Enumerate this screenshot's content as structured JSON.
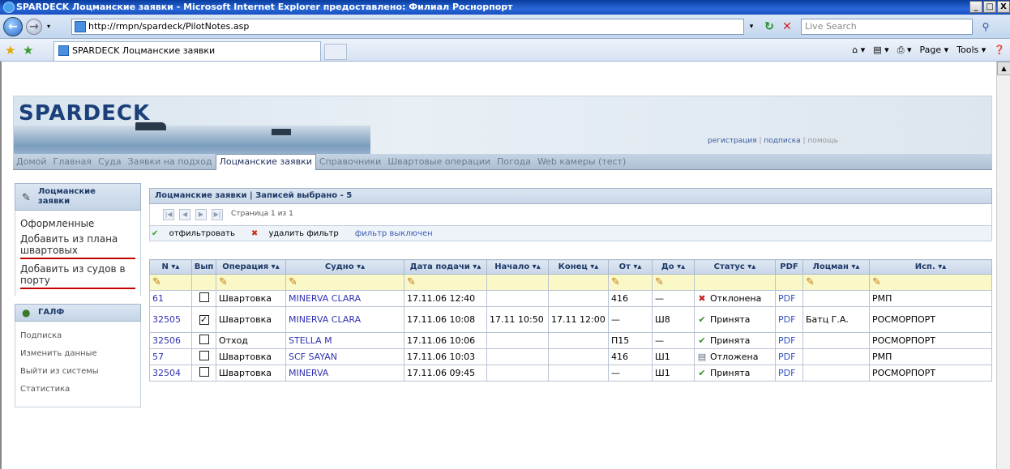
{
  "window": {
    "title": "SPARDECK Лоцманские заявки - Microsoft Internet Explorer предоставлено: Филиал Роснорпорт",
    "buttons": [
      "_",
      "□",
      "X"
    ]
  },
  "address_bar": {
    "url": "http://rmpn/spardeck/PilotNotes.asp",
    "search_placeholder": "Live Search"
  },
  "favorites_bar": {
    "tab_title": "SPARDECK Лоцманские заявки",
    "toolbar_items": [
      "Page ▾",
      "Tools ▾"
    ]
  },
  "site": {
    "logo": "SPARDECK",
    "links": {
      "register": "регистрация",
      "subscribe": "подписка",
      "help": "помощь",
      "sep": " | "
    },
    "nav": [
      "Домой",
      "Главная",
      "Суда",
      "Заявки на подход",
      "Лоцманские заявки",
      "Справочники",
      "Швартовые операции",
      "Погода",
      "Web камеры (тест)"
    ]
  },
  "sidebar": {
    "section1_title": "Лоцманские заявки",
    "section1_items": [
      "Оформленные",
      "Добавить из плана швартовых",
      "Добавить из судов в порту"
    ],
    "section2_title": "ГАЛФ",
    "section2_items": [
      "Подписка",
      "Изменить данные",
      "Выйти из системы",
      "Статистика"
    ]
  },
  "grid": {
    "title": "Лоцманские заявки | Записей выбрано - 5",
    "pager_info": "Страница 1 из 1",
    "filter_apply": "отфильтровать",
    "filter_remove": "удалить фильтр",
    "filter_status": "фильтр выключен",
    "columns": [
      "N ▾▴",
      "Вып",
      "Операция ▾▴",
      "Судно ▾▴",
      "Дата подачи ▾▴",
      "Начало ▾▴",
      "Конец ▾▴",
      "От ▾▴",
      "До ▾▴",
      "Статус ▾▴",
      "PDF",
      "Лоцман ▾▴",
      "Исп. ▾▴"
    ],
    "rows": [
      {
        "n": "61",
        "done": false,
        "op": "Швартовка",
        "vessel": "MINERVA CLARA",
        "date": "17.11.06 12:40",
        "start": "",
        "end": "",
        "from": "416",
        "to": "—",
        "status": "Отклонена",
        "status_kind": "rejected",
        "pdf": "PDF",
        "pilot": "",
        "exec": "РМП"
      },
      {
        "n": "32505",
        "done": true,
        "op": "Швартовка",
        "vessel": "MINERVA CLARA",
        "date": "17.11.06 10:08",
        "start": "17.11 10:50",
        "end": "17.11 12:00",
        "from": "—",
        "to": "Ш8",
        "status": "Принята",
        "status_kind": "accepted",
        "pdf": "PDF",
        "pilot": "Батц Г.А.",
        "exec": "РОСМОРПОРТ"
      },
      {
        "n": "32506",
        "done": false,
        "op": "Отход",
        "vessel": "STELLA M",
        "date": "17.11.06 10:06",
        "start": "",
        "end": "",
        "from": "П15",
        "to": "—",
        "status": "Принята",
        "status_kind": "accepted",
        "pdf": "PDF",
        "pilot": "",
        "exec": "РОСМОРПОРТ"
      },
      {
        "n": "57",
        "done": false,
        "op": "Швартовка",
        "vessel": "SCF SAYAN",
        "date": "17.11.06 10:03",
        "start": "",
        "end": "",
        "from": "416",
        "to": "Ш1",
        "status": "Отложена",
        "status_kind": "postponed",
        "pdf": "PDF",
        "pilot": "",
        "exec": "РМП"
      },
      {
        "n": "32504",
        "done": false,
        "op": "Швартовка",
        "vessel": "MINERVA",
        "date": "17.11.06 09:45",
        "start": "",
        "end": "",
        "from": "—",
        "to": "Ш1",
        "status": "Принята",
        "status_kind": "accepted",
        "pdf": "PDF",
        "pilot": "",
        "exec": "РОСМОРПОРТ"
      }
    ]
  },
  "colors": {
    "titlebar": "#2a68d8",
    "link": "#3030b0",
    "edit_row": "#fbf8c8",
    "underline_red": "#c00000"
  }
}
